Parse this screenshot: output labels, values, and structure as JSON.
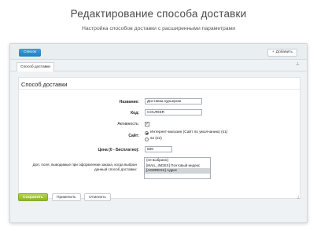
{
  "page": {
    "title": "Редактирование способа доставки",
    "subtitle": "Настройка способов доставки с расширенными параметрами"
  },
  "toolbar": {
    "back_label": "Список",
    "add_label": "Добавить"
  },
  "tab": {
    "label": "Способ доставки"
  },
  "section": {
    "title": "Способ доставки"
  },
  "form": {
    "name_label": "Название:",
    "name_value": "Доставка курьером",
    "code_label": "Код:",
    "code_value": "COURIER",
    "active_label": "Активность:",
    "active_checked": true,
    "site_label": "Сайт:",
    "site_options": [
      "Интернет-магазин (Сайт по умолчанию) (s1)",
      "s2 (s2)"
    ],
    "price_label": "Цена (0 - Бесплатно):",
    "price_value": "500",
    "fields_label": "Доп. поля, выводимые при оформлении заказа, когда выбран данный способ доставки:",
    "fields_options": [
      "(не выбрано)",
      "[MAIL_INDEX] Почтовый индекс",
      "[ADDRESS] Адрес"
    ]
  },
  "buttons": {
    "save": "Сохранить",
    "apply": "Применить",
    "cancel": "Отменить"
  },
  "icons": {
    "plus": "plus-icon",
    "pin": "pin-icon"
  }
}
